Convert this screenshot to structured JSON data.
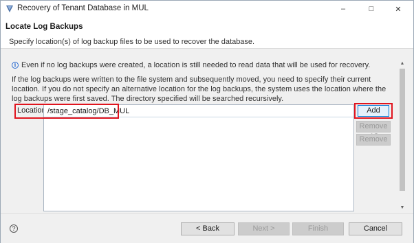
{
  "window": {
    "title": "Recovery of Tenant Database in MUL",
    "controls": {
      "minimize": "–",
      "maximize": "□",
      "close": "✕"
    }
  },
  "header": {
    "title": "Locate Log Backups",
    "description": "Specify location(s) of log backup files to be used to recover the database."
  },
  "content": {
    "info_icon": "i",
    "info_text": "Even if no log backups were created, a location is still needed to read data that will be used for recovery.",
    "paragraph": "If the log backups were written to the file system and subsequently moved, you need to specify their current location. If you do not specify an alternative location for the log backups, the system uses the location where the log backups were first saved. The directory specified will be searched recursively.",
    "locations_label": "Locations:",
    "locations": [
      "/stage_catalog/DB_MUL"
    ],
    "buttons": {
      "add": "Add",
      "remove_all": "Remove All",
      "remove": "Remove"
    },
    "highlight_color": "#e0141e"
  },
  "footer": {
    "help_icon": "?",
    "back": "< Back",
    "next": "Next >",
    "finish": "Finish",
    "cancel": "Cancel"
  }
}
